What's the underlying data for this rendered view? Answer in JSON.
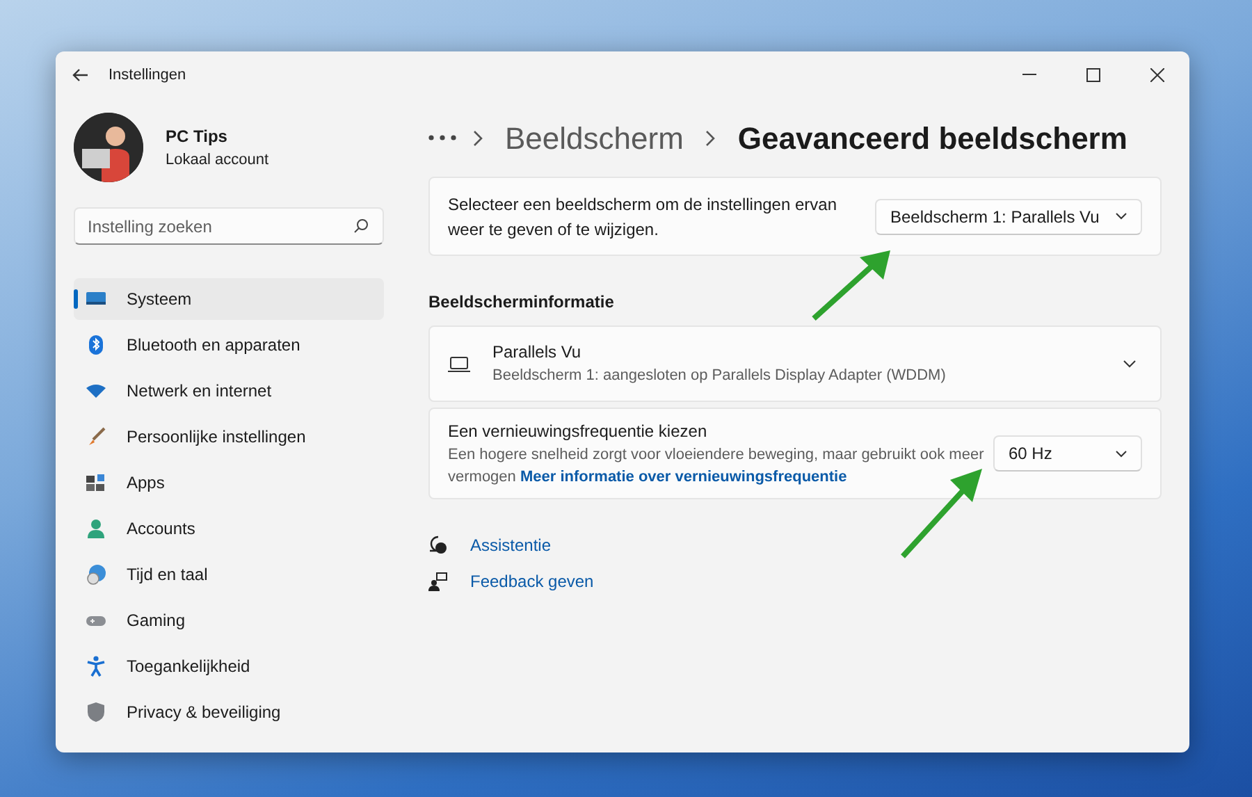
{
  "window": {
    "title": "Instellingen"
  },
  "account": {
    "name": "PC Tips",
    "type": "Lokaal account"
  },
  "search": {
    "placeholder": "Instelling zoeken"
  },
  "sidebar": {
    "items": [
      {
        "label": "Systeem",
        "selected": true
      },
      {
        "label": "Bluetooth en apparaten",
        "selected": false
      },
      {
        "label": "Netwerk en internet",
        "selected": false
      },
      {
        "label": "Persoonlijke instellingen",
        "selected": false
      },
      {
        "label": "Apps",
        "selected": false
      },
      {
        "label": "Accounts",
        "selected": false
      },
      {
        "label": "Tijd en taal",
        "selected": false
      },
      {
        "label": "Gaming",
        "selected": false
      },
      {
        "label": "Toegankelijkheid",
        "selected": false
      },
      {
        "label": "Privacy & beveiliging",
        "selected": false
      }
    ]
  },
  "breadcrumb": {
    "items": [
      "Beeldscherm",
      "Geavanceerd beeldscherm"
    ]
  },
  "select_display": {
    "label": "Selecteer een beeldscherm om de instellingen ervan weer te geven of te wijzigen.",
    "value": "Beeldscherm 1: Parallels Vu"
  },
  "section_heading": "Beeldscherminformatie",
  "display_info": {
    "title": "Parallels Vu",
    "subtitle": "Beeldscherm 1: aangesloten op Parallels Display Adapter (WDDM)",
    "expanded": false
  },
  "refresh_rate": {
    "title": "Een vernieuwingsfrequentie kiezen",
    "description": "Een hogere snelheid zorgt voor vloeiendere beweging, maar gebruikt ook meer vermogen",
    "link": "Meer informatie over vernieuwingsfrequentie",
    "value": "60 Hz"
  },
  "help_links": [
    {
      "label": "Assistentie"
    },
    {
      "label": "Feedback geven"
    }
  ]
}
